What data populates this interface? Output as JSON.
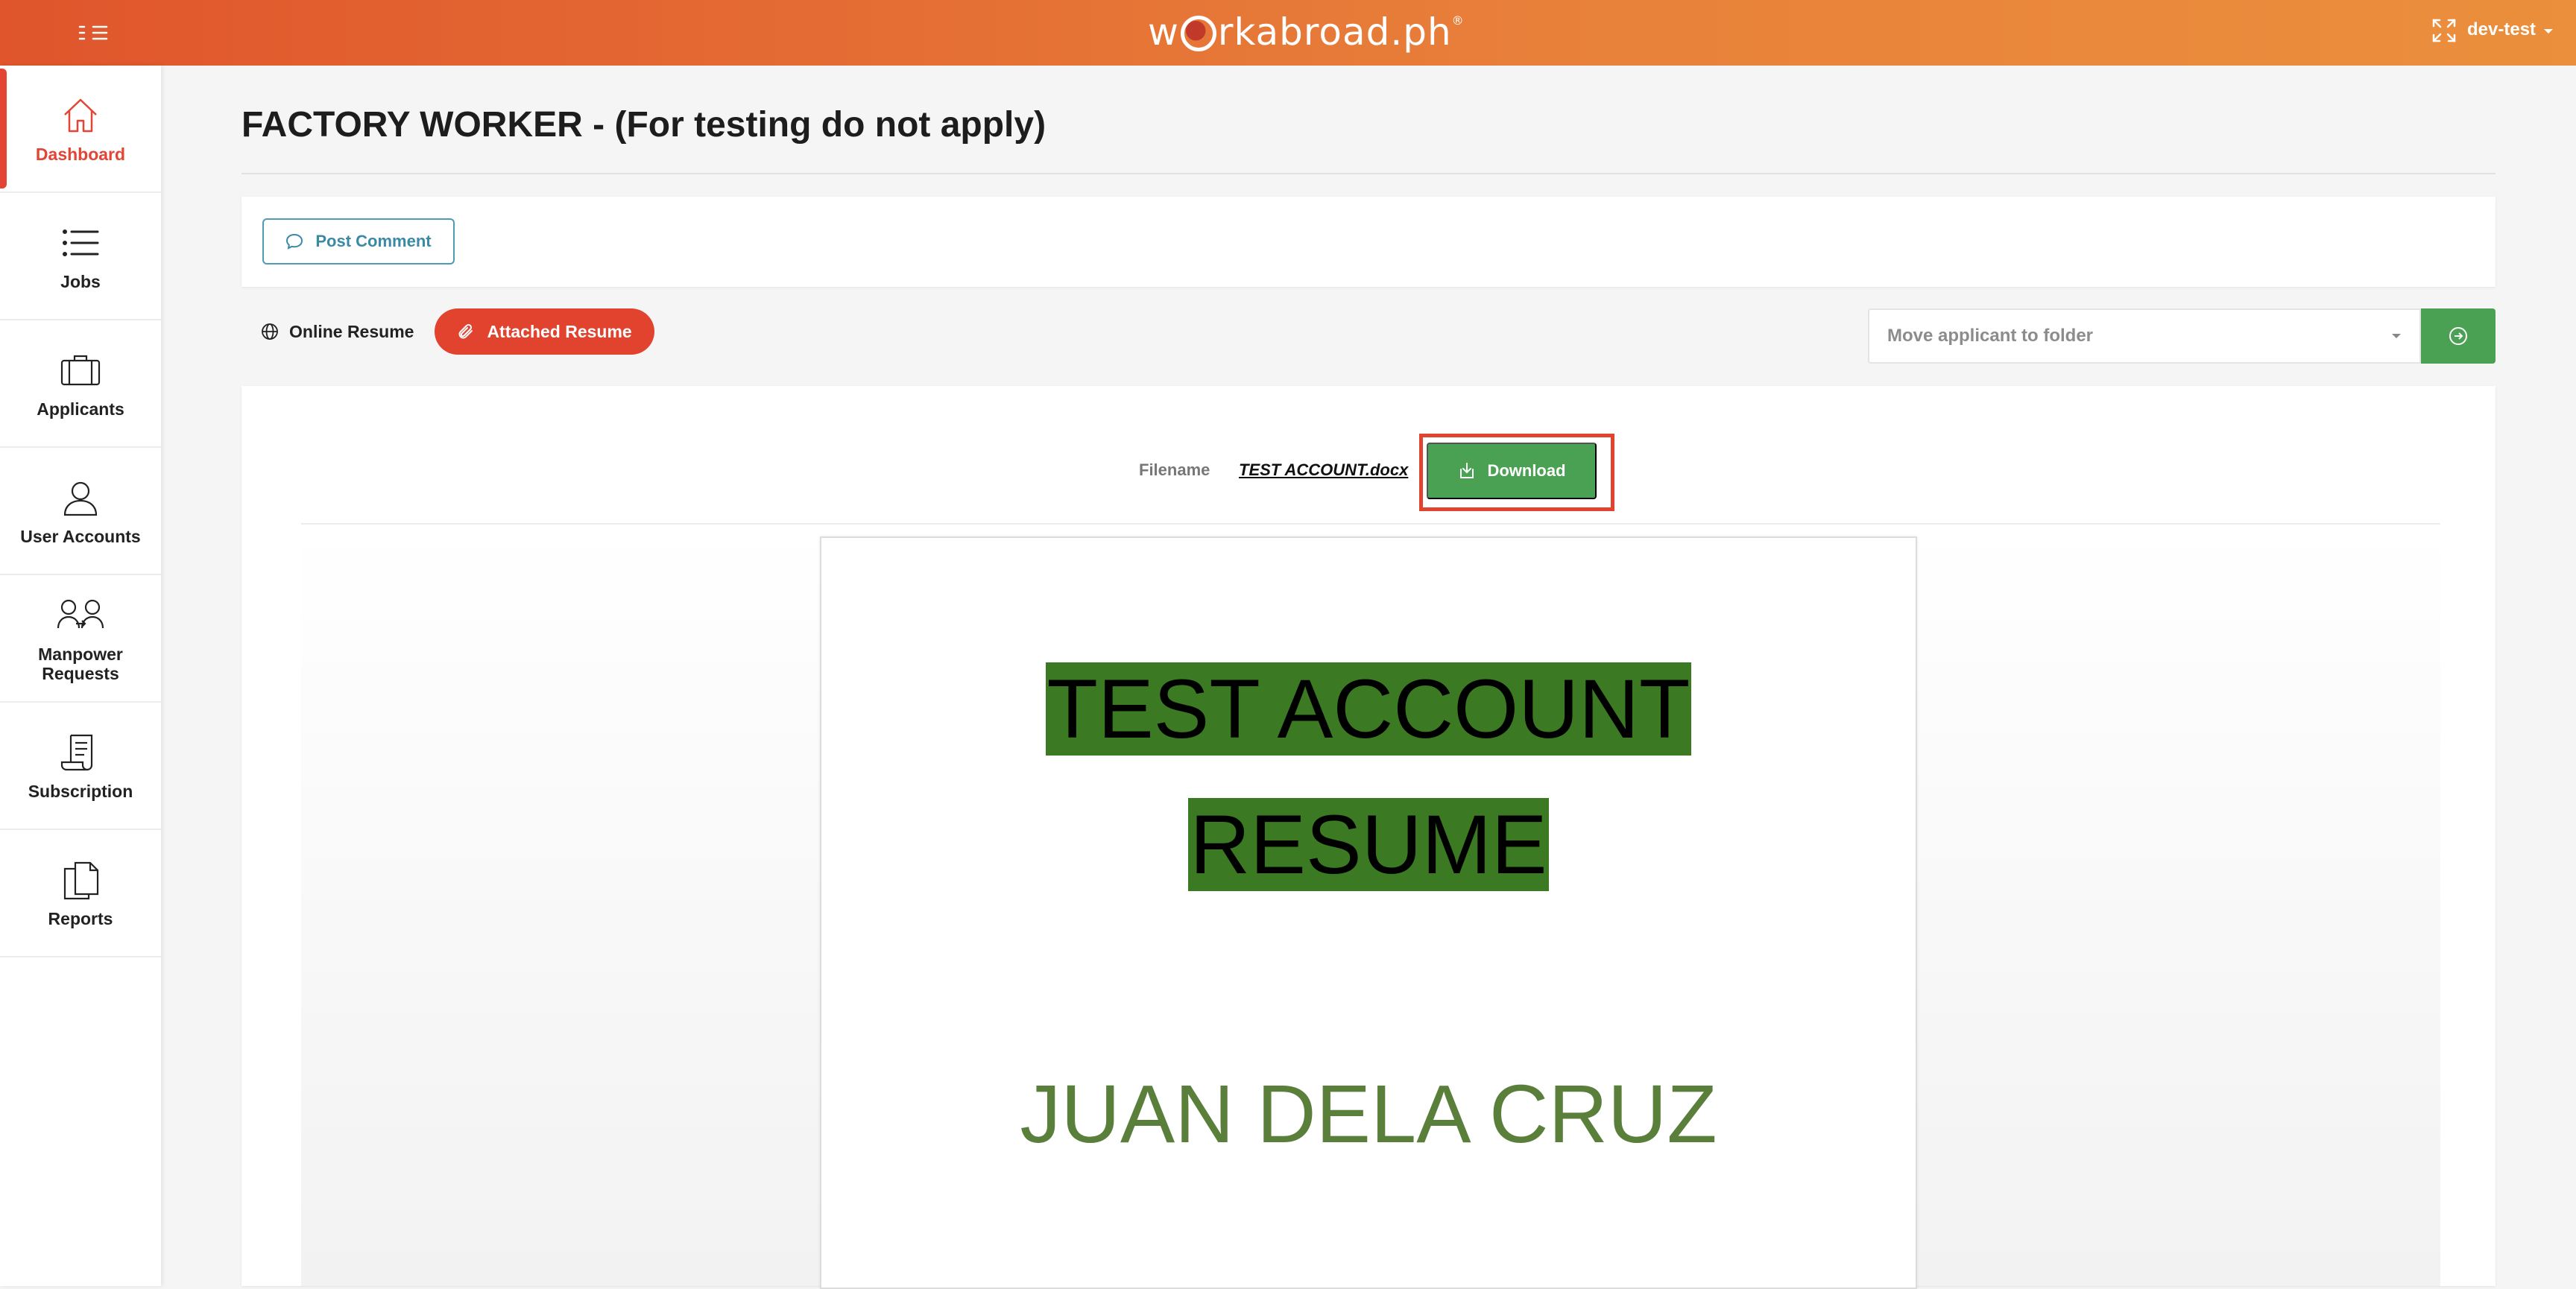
{
  "app": {
    "logo_text_pre": "w",
    "logo_text_post": "rkabroad.ph",
    "logo_reg": "®",
    "user": "dev-test"
  },
  "sidebar": {
    "items": [
      {
        "label": "Dashboard",
        "icon": "home-icon",
        "active": true
      },
      {
        "label": "Jobs",
        "icon": "list-icon"
      },
      {
        "label": "Applicants",
        "icon": "briefcase-icon"
      },
      {
        "label": "User Accounts",
        "icon": "user-icon"
      },
      {
        "label": "Manpower Requests",
        "icon": "users-icon"
      },
      {
        "label": "Subscription",
        "icon": "scroll-icon"
      },
      {
        "label": "Reports",
        "icon": "documents-icon"
      }
    ]
  },
  "page": {
    "title": "FACTORY WORKER - (For testing do not apply)"
  },
  "comment": {
    "button_label": "Post Comment"
  },
  "tabs": {
    "online": "Online Resume",
    "attached": "Attached Resume"
  },
  "folder": {
    "placeholder": "Move applicant to folder"
  },
  "file": {
    "label": "Filename",
    "name": "TEST ACCOUNT.docx",
    "download_label": "Download"
  },
  "document": {
    "title_line1": "TEST ACCOUNT",
    "title_line2": "RESUME",
    "name": "JUAN DELA CRUZ"
  },
  "colors": {
    "accent": "#e2432f",
    "topbar_start": "#e0552c",
    "topbar_end": "#eb8f3c",
    "success": "#4aa153",
    "info": "#3a8aa5"
  }
}
